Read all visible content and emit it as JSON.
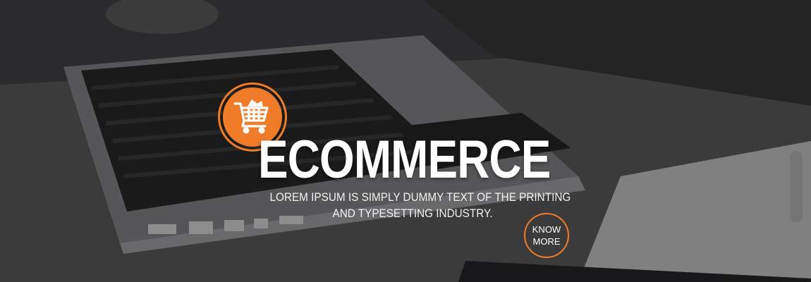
{
  "hero": {
    "title": "ECOMMERCE",
    "tagline_line1": "LOREM IPSUM IS SIMPLY DUMMY TEXT OF THE PRINTING",
    "tagline_line2": "AND TYPESETTING INDUSTRY.",
    "cta_line1": "KNOW",
    "cta_line2": "MORE",
    "logo_icon": "shopping-cart-icon",
    "accent_color": "#f07c2a"
  }
}
